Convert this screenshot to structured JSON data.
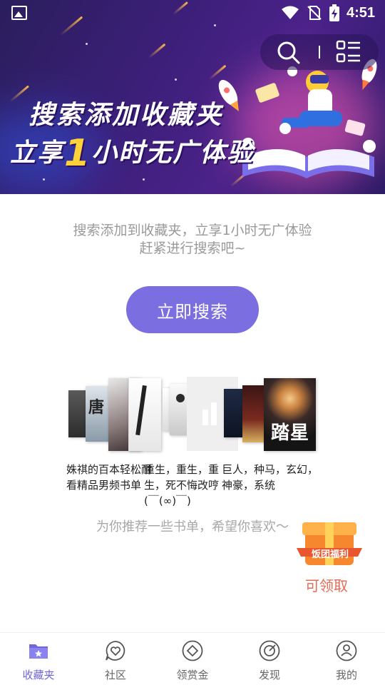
{
  "status_bar": {
    "time": "4:51",
    "icons": [
      "image-icon",
      "wifi-icon",
      "no-sim-icon",
      "battery-charging-icon"
    ]
  },
  "banner": {
    "title": "搜索添加收藏夹",
    "subtitle_prefix": "立享",
    "subtitle_highlight": "1",
    "subtitle_suffix": "小时无广体验",
    "tools": [
      "search-icon",
      "menu-list-icon"
    ]
  },
  "hint": {
    "line1": "搜索添加到收藏夹，立享1小时无广体验",
    "line2": "赶紧进行搜索吧~"
  },
  "search_button": {
    "label": "立即搜索"
  },
  "booklists": [
    {
      "title": "姝祺的百本轻松耐看精品男频书单",
      "covers": [
        {
          "text": ""
        },
        {
          "text": "唐"
        },
        {
          "text": ""
        },
        {
          "text": ""
        }
      ]
    },
    {
      "title": "重生，重生，重生，死不悔改哼(￣(∞)￣)",
      "covers": [
        {
          "text": ""
        },
        {
          "text": ""
        },
        {
          "text": ""
        }
      ]
    },
    {
      "title": "巨人，种马，玄幻，神豪，系统",
      "covers": [
        {
          "text": ""
        },
        {
          "text": ""
        },
        {
          "text": "踏星"
        }
      ]
    }
  ],
  "recommend_text": "为你推荐一些书单，希望你喜欢～",
  "gift": {
    "badge": "饭团福利",
    "label": "可领取"
  },
  "nav": {
    "items": [
      {
        "label": "收藏夹",
        "icon": "folder-star-icon",
        "active": true
      },
      {
        "label": "社区",
        "icon": "chat-heart-icon",
        "active": false
      },
      {
        "label": "领赏金",
        "icon": "diamond-coin-icon",
        "active": false
      },
      {
        "label": "发现",
        "icon": "compass-icon",
        "active": false
      },
      {
        "label": "我的",
        "icon": "user-icon",
        "active": false
      }
    ]
  },
  "colors": {
    "accent": "#7b6ee0",
    "nav_active": "#6f66d8",
    "banner_highlight": "#ffd23a",
    "gift_text": "#e76a55"
  }
}
